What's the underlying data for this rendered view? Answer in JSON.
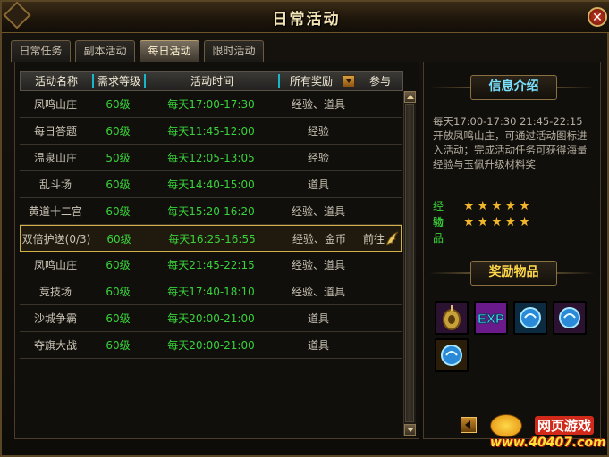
{
  "window": {
    "title": "日常活动",
    "close_label": "✕"
  },
  "tabs": [
    {
      "label": "日常任务",
      "active": false
    },
    {
      "label": "副本活动",
      "active": false
    },
    {
      "label": "每日活动",
      "active": true
    },
    {
      "label": "限时活动",
      "active": false
    }
  ],
  "table": {
    "headers": {
      "name": "活动名称",
      "level": "需求等级",
      "time": "活动时间",
      "reward": "所有奖励",
      "join": "参与"
    },
    "rows": [
      {
        "name": "凤鸣山庄",
        "level": "60级",
        "time": "每天17:00-17:30",
        "reward": "经验、道具",
        "join": ""
      },
      {
        "name": "每日答题",
        "level": "60级",
        "time": "每天11:45-12:00",
        "reward": "经验",
        "join": ""
      },
      {
        "name": "温泉山庄",
        "level": "50级",
        "time": "每天12:05-13:05",
        "reward": "经验",
        "join": ""
      },
      {
        "name": "乱斗场",
        "level": "60级",
        "time": "每天14:40-15:00",
        "reward": "道具",
        "join": ""
      },
      {
        "name": "黄道十二宫",
        "level": "60级",
        "time": "每天15:20-16:20",
        "reward": "经验、道具",
        "join": ""
      },
      {
        "name": "双倍护送(0/3)",
        "level": "60级",
        "time": "每天16:25-16:55",
        "reward": "经验、金币",
        "join": "前往"
      },
      {
        "name": "凤鸣山庄",
        "level": "60级",
        "time": "每天21:45-22:15",
        "reward": "经验、道具",
        "join": ""
      },
      {
        "name": "竞技场",
        "level": "60级",
        "time": "每天17:40-18:10",
        "reward": "经验、道具",
        "join": ""
      },
      {
        "name": "沙城争霸",
        "level": "60级",
        "time": "每天20:00-21:00",
        "reward": "道具",
        "join": ""
      },
      {
        "name": "夺旗大战",
        "level": "60级",
        "time": "每天20:00-21:00",
        "reward": "道具",
        "join": ""
      }
    ],
    "selected_row": 5
  },
  "info": {
    "heading": "信息介绍",
    "description": "每天17:00-17:30 21:45-22:15开放凤鸣山庄，可通过活动图标进入活动；完成活动任务可获得海量经验与玉佩升级材料奖",
    "exp_label": "经验",
    "exp_stars": "★★★★★",
    "item_label": "物品",
    "item_stars": "★★★★★"
  },
  "rewards": {
    "heading": "奖励物品",
    "items": [
      {
        "icon": "jade-pendant-icon",
        "border": "#c050d0"
      },
      {
        "icon": "exp-icon",
        "text": "EXP",
        "border": "#c050d0"
      },
      {
        "icon": "blue-orb-icon",
        "border": "#3a9ad8"
      },
      {
        "icon": "blue-orb-icon",
        "border": "#c050d0"
      },
      {
        "icon": "blue-orb-icon",
        "border": "#e0a020"
      }
    ]
  },
  "logo": {
    "name": "网页游戏",
    "url": "www.40407.com"
  }
}
